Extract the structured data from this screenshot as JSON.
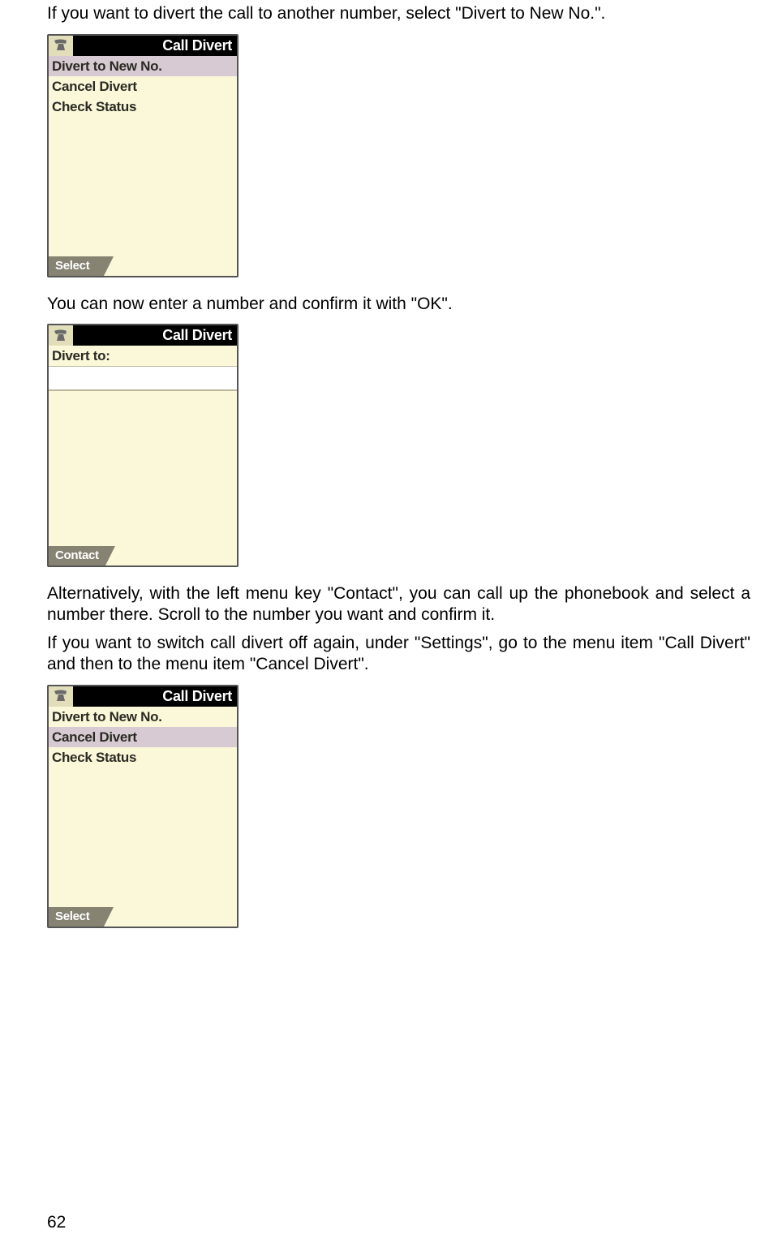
{
  "paragraphs": {
    "p1": "If you want to divert the call to another number, select \"Divert to New No.\".",
    "p2": "You can now enter a number and confirm it with \"OK\".",
    "p3": "Alternatively, with the left menu key \"Contact\", you can call up the phonebook and select a number there. Scroll to the number you want and confirm it.",
    "p4": "If you want to switch call divert off again, under \"Settings\", go to the menu item \"Call Divert\" and then to the menu item \"Cancel Divert\"."
  },
  "page_number": "62",
  "screens": {
    "screen1": {
      "title": "Call Divert",
      "items": [
        "Divert to New No.",
        "Cancel Divert",
        "Check Status"
      ],
      "selected_index": 0,
      "softkey_left": "Select",
      "softkey_right": ""
    },
    "screen2": {
      "title": "Call Divert",
      "label": "Divert to:",
      "input_value": "",
      "softkey_left": "Contact",
      "softkey_right": ""
    },
    "screen3": {
      "title": "Call Divert",
      "items": [
        "Divert to New No.",
        "Cancel Divert",
        "Check Status"
      ],
      "selected_index": 1,
      "softkey_left": "Select",
      "softkey_right": ""
    }
  }
}
